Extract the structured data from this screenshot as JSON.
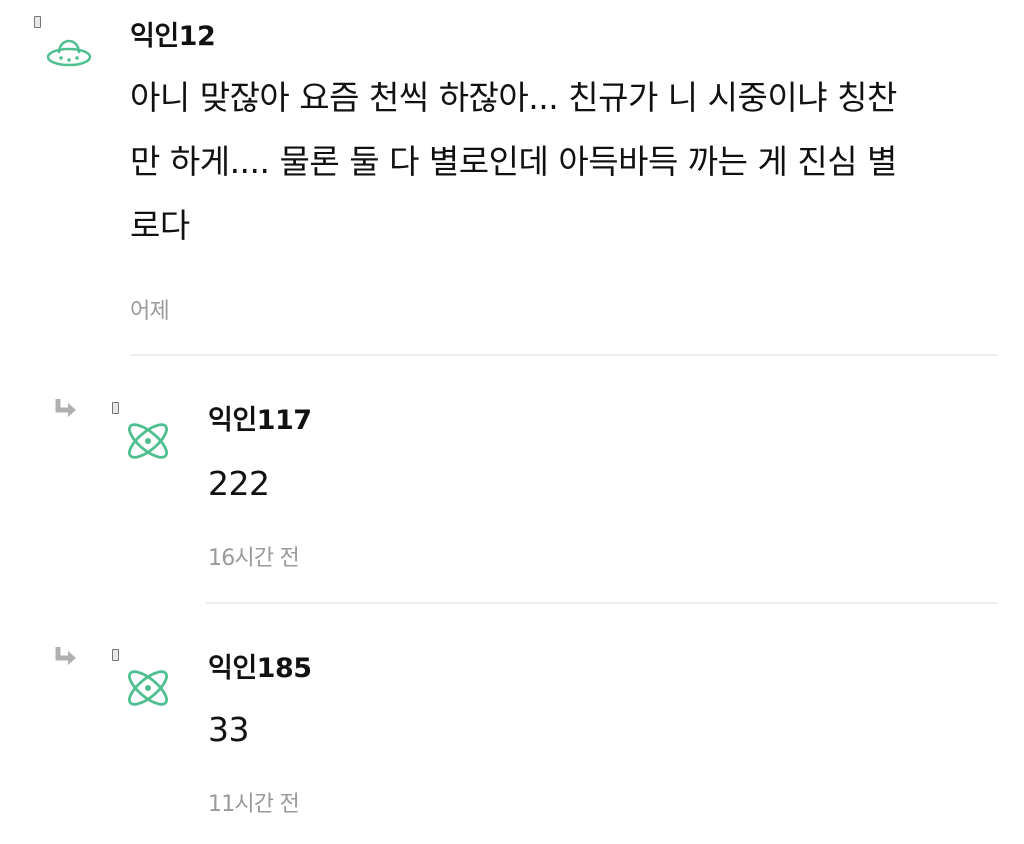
{
  "comments": [
    {
      "nickname": "익인12",
      "lines": [
        "아니 맞잖아 요즘 천씩 하잖아... 친규가 니 시중이냐 칭찬",
        "만 하게.... 물론 둘 다 별로인데 아득바득 까는 게 진심 별",
        "로다"
      ],
      "time": "어제",
      "avatar_icon": "ufo-icon"
    }
  ],
  "replies": [
    {
      "nickname": "익인117",
      "text": "222",
      "time": "16시간 전",
      "avatar_icon": "atom-icon"
    },
    {
      "nickname": "익인185",
      "text": "33",
      "time": "11시간 전",
      "avatar_icon": "atom-icon"
    }
  ],
  "colors": {
    "avatar_green": "#4fbf8f",
    "divider": "#eeeeee",
    "time_gray": "#9a9a9a",
    "reply_arrow": "#b0b0b0"
  }
}
